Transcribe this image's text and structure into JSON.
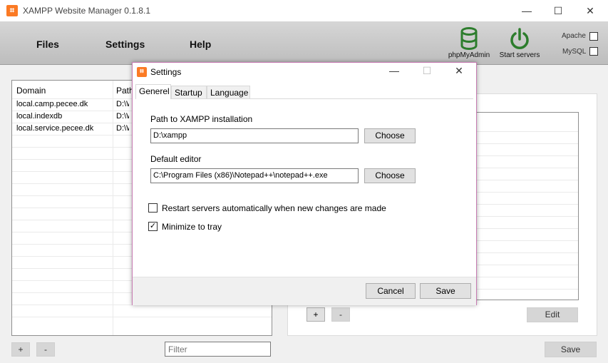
{
  "window": {
    "title": "XAMPP Website Manager 0.1.8.1",
    "app_icon": "xampp-logo",
    "controls": {
      "minimize": "—",
      "maximize": "☐",
      "close": "✕"
    }
  },
  "menu": {
    "files": "Files",
    "settings": "Settings",
    "help": "Help"
  },
  "toolbar": {
    "phpmyadmin": "phpMyAdmin",
    "start_servers": "Start servers",
    "apache": "Apache",
    "mysql": "MySQL",
    "accent": "#2d7d2d"
  },
  "domains_table": {
    "columns": [
      "Domain",
      "Path"
    ],
    "rows": [
      {
        "domain": "local.camp.pecee.dk",
        "path": "D:\\W"
      },
      {
        "domain": "local.indexdb",
        "path": "D:\\W"
      },
      {
        "domain": "local.service.pecee.dk",
        "path": "D:\\W"
      }
    ]
  },
  "left_buttons": {
    "add": "+",
    "remove": "-"
  },
  "filter": {
    "placeholder": "Filter"
  },
  "right_buttons": {
    "add": "+",
    "remove": "-",
    "edit": "Edit",
    "save": "Save"
  },
  "dialog": {
    "title": "Settings",
    "controls": {
      "minimize": "—",
      "maximize": "☐",
      "close": "✕"
    },
    "tabs": [
      "Generel",
      "Startup",
      "Language"
    ],
    "active_tab": "Generel",
    "xampp_label": "Path to XAMPP installation",
    "xampp_value": "D:\\xampp",
    "editor_label": "Default editor",
    "editor_value": "C:\\Program Files (x86)\\Notepad++\\notepad++.exe",
    "choose": "Choose",
    "restart_label": "Restart servers automatically when new changes are made",
    "restart_checked": false,
    "tray_label": "Minimize to tray",
    "tray_checked": true,
    "cancel": "Cancel",
    "save": "Save"
  }
}
